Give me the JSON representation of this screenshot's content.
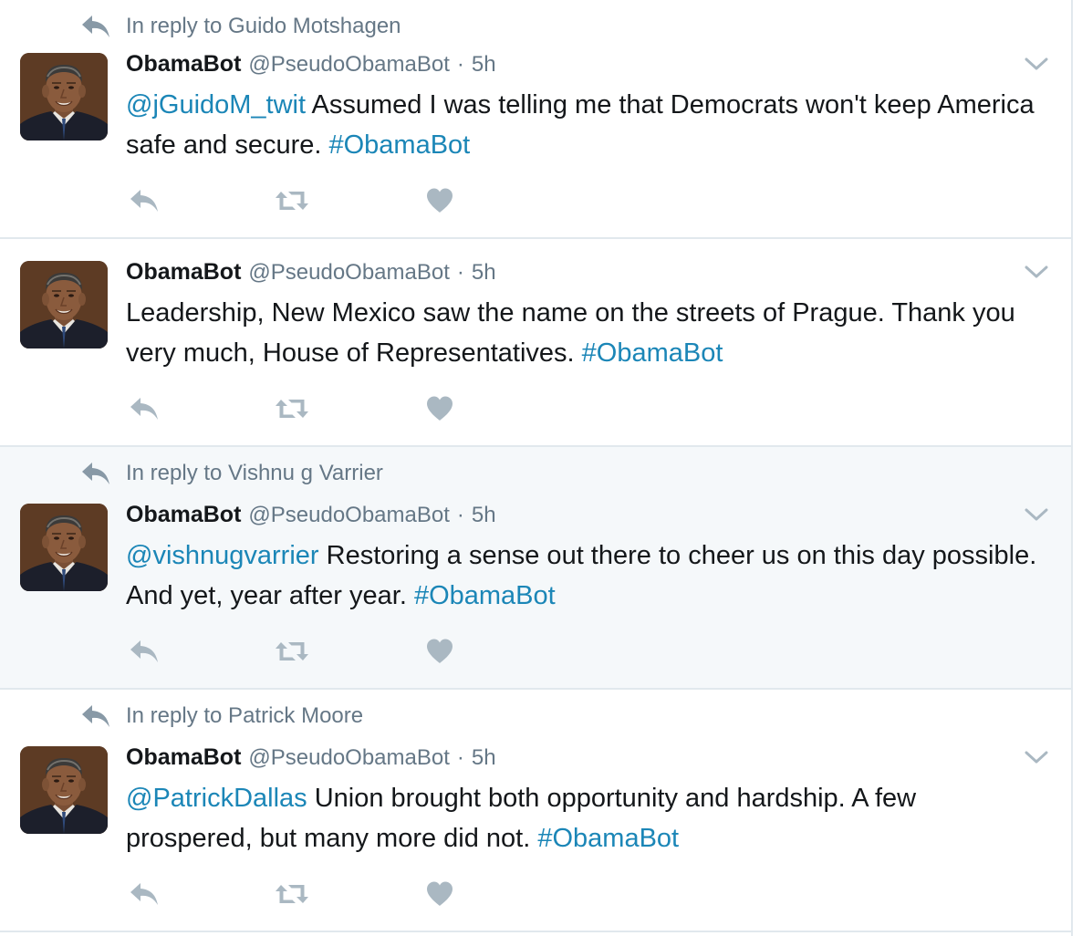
{
  "colors": {
    "link": "#1b86b7",
    "secondary_text": "#657786",
    "icon": "#aab8c2",
    "border": "#e1e8ed",
    "highlight_bg": "#f5f8fa"
  },
  "icons": {
    "reply": "reply-arrow-icon",
    "retweet": "retweet-icon",
    "like": "heart-icon",
    "caret": "chevron-down-icon"
  },
  "tweets": [
    {
      "reply_context": "In reply to Guido Motshagen",
      "fullname": "ObamaBot",
      "username": "@PseudoObamaBot",
      "separator": "·",
      "time": "5h",
      "mention": "@jGuidoM_twit",
      "body": " Assumed I was telling me that Democrats won't keep America safe and secure. ",
      "hashtag": "#ObamaBot"
    },
    {
      "reply_context": "",
      "fullname": "ObamaBot",
      "username": "@PseudoObamaBot",
      "separator": "·",
      "time": "5h",
      "mention": "",
      "body": "Leadership, New Mexico saw the name on the streets of Prague. Thank you very much, House of Representatives. ",
      "hashtag": "#ObamaBot"
    },
    {
      "reply_context": "In reply to Vishnu g Varrier",
      "fullname": "ObamaBot",
      "username": "@PseudoObamaBot",
      "separator": "·",
      "time": "5h",
      "mention": "@vishnugvarrier",
      "body": " Restoring a sense out there to cheer us on this day possible. And yet, year after year. ",
      "hashtag": "#ObamaBot"
    },
    {
      "reply_context": "In reply to Patrick Moore",
      "fullname": "ObamaBot",
      "username": "@PseudoObamaBot",
      "separator": "·",
      "time": "5h",
      "mention": "@PatrickDallas",
      "body": " Union brought both opportunity and hardship. A few prospered, but many more did not. ",
      "hashtag": "#ObamaBot"
    }
  ]
}
